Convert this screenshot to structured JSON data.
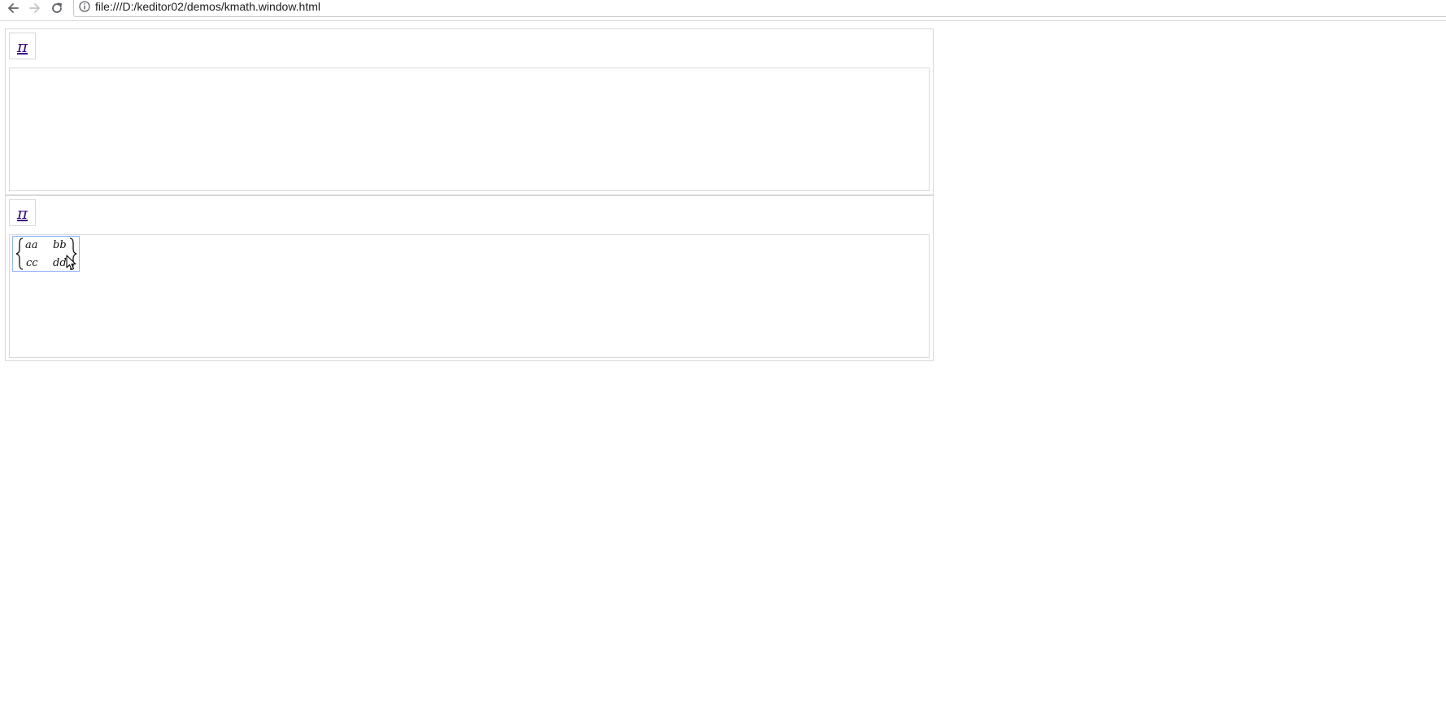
{
  "browser": {
    "url": "file:///D:/keditor02/demos/kmath.window.html"
  },
  "editors": [
    {
      "pi_label": "π"
    },
    {
      "pi_label": "π",
      "formula": {
        "matrix": [
          [
            "aa",
            "bb"
          ],
          [
            "cc",
            "dd"
          ]
        ]
      }
    }
  ],
  "icons": {
    "back": "back-arrow-icon",
    "forward": "forward-arrow-icon",
    "reload": "reload-icon",
    "info": "info-icon",
    "cursor": "mouse-cursor-icon"
  },
  "colors": {
    "pi_link": "#3a0e83",
    "formula_border": "#8fb3ff",
    "panel_border": "#d9d9d9"
  }
}
